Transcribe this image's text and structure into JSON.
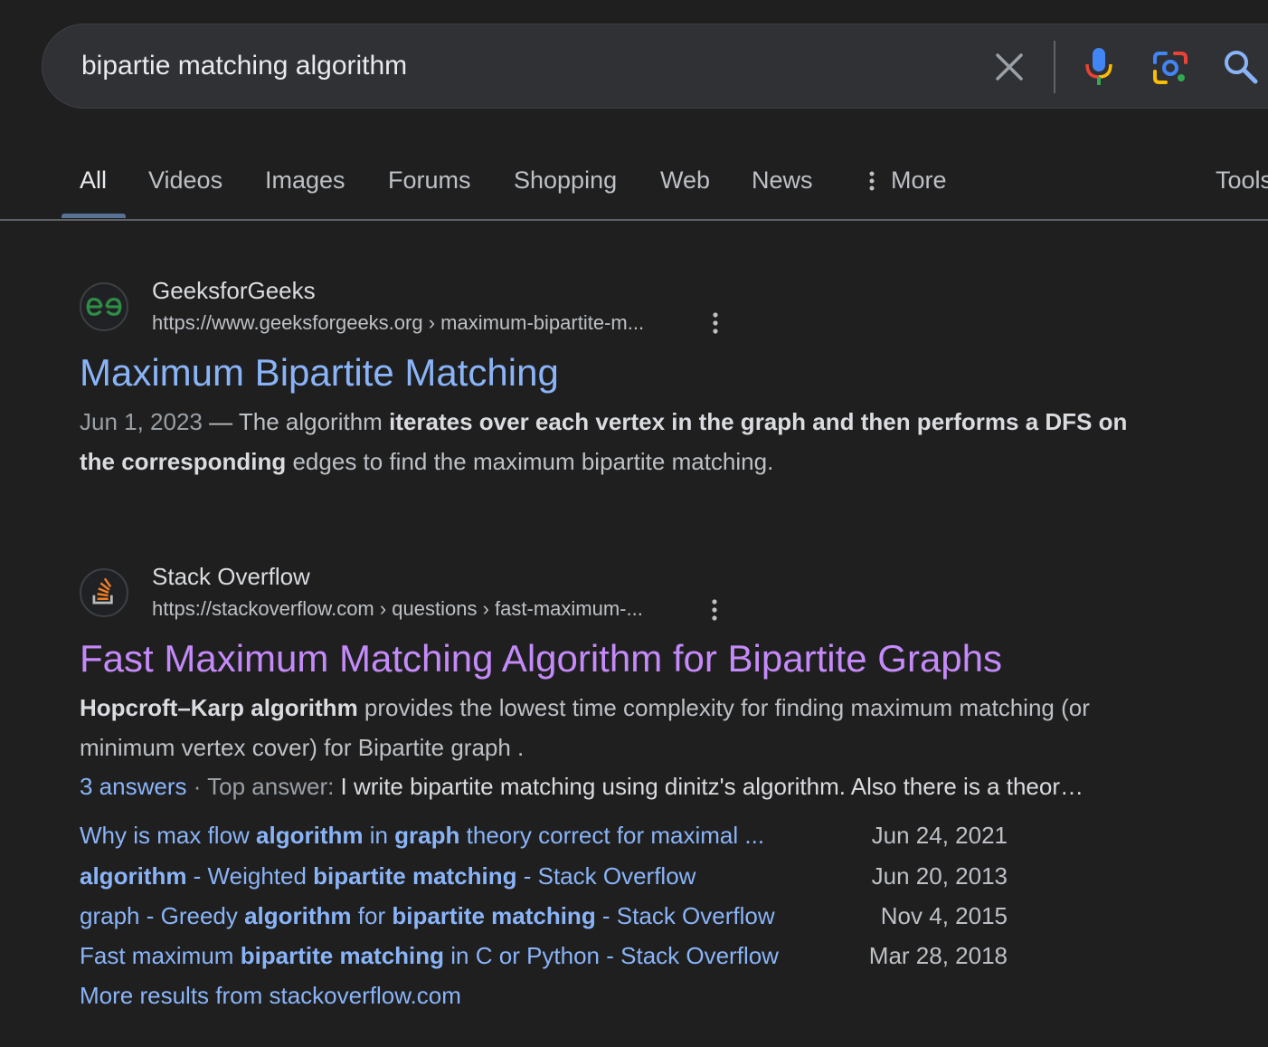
{
  "search": {
    "query": "bipartie matching algorithm"
  },
  "tabs": [
    {
      "label": "All"
    },
    {
      "label": "Videos"
    },
    {
      "label": "Images"
    },
    {
      "label": "Forums"
    },
    {
      "label": "Shopping"
    },
    {
      "label": "Web"
    },
    {
      "label": "News"
    },
    {
      "label": "More"
    },
    {
      "label": "Tools"
    }
  ],
  "results": [
    {
      "site_name": "GeeksforGeeks",
      "url": "https://www.geeksforgeeks.org › maximum-bipartite-m...",
      "title": "Maximum Bipartite Matching",
      "date": "Jun 1, 2023",
      "dash": " — ",
      "snippet_parts": [
        "The algorithm ",
        "iterates over each vertex in the graph and then performs a DFS on the corresponding",
        " edges to find the maximum bipartite matching."
      ]
    },
    {
      "site_name": "Stack Overflow",
      "url": "https://stackoverflow.com › questions › fast-maximum-...",
      "title": "Fast Maximum Matching Algorithm for Bipartite Graphs",
      "snippet_parts": [
        "Hopcroft–Karp algorithm",
        " provides the lowest time complexity for finding maximum matching (or minimum vertex cover) for Bipartite graph ."
      ],
      "answers_count": "3 answers",
      "answers_sep": " · ",
      "top_answer_label": "Top answer: ",
      "top_answer_text": "I write bipartite matching using dinitz's algorithm. Also there is a theor…",
      "sublinks": [
        {
          "parts": [
            "Why is max flow ",
            "algorithm",
            " in ",
            "graph",
            " theory correct for maximal ..."
          ],
          "date": "Jun 24, 2021"
        },
        {
          "parts": [
            "algorithm",
            " - Weighted ",
            "bipartite matching",
            " - Stack Overflow"
          ],
          "date": "Jun 20, 2013"
        },
        {
          "parts": [
            "graph - Greedy ",
            "algorithm",
            " for ",
            "bipartite matching",
            " - Stack Overflow"
          ],
          "date": "Nov 4, 2015"
        },
        {
          "parts": [
            "Fast maximum ",
            "bipartite matching",
            " in C or Python - Stack Overflow"
          ],
          "date": "Mar 28, 2018"
        }
      ],
      "more_results": "More results from stackoverflow.com"
    }
  ],
  "colors": {
    "background": "#1f1f1f",
    "link": "#8ab4f8",
    "visited": "#c58af9",
    "gfg_green": "#2f8d46",
    "so_orange": "#f48024"
  }
}
